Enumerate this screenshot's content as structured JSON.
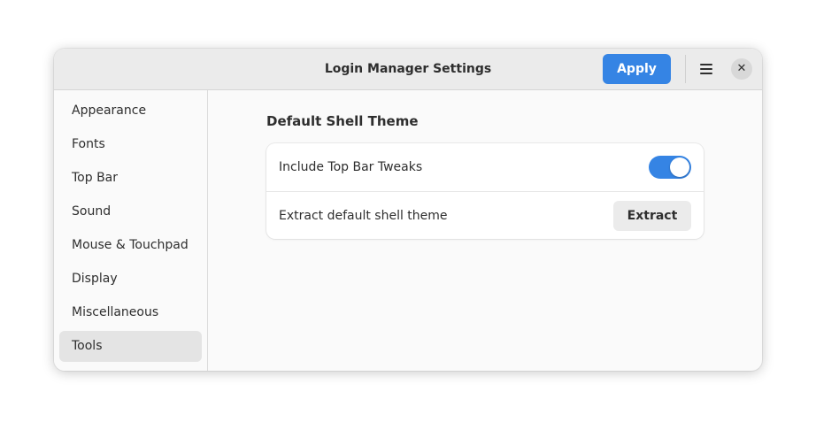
{
  "window": {
    "title": "Login Manager Settings"
  },
  "header": {
    "apply_label": "Apply",
    "menu_icon": "hamburger-menu-icon",
    "close_icon": "close-icon",
    "close_glyph": "✕"
  },
  "sidebar": {
    "items": [
      {
        "label": "Appearance",
        "selected": false
      },
      {
        "label": "Fonts",
        "selected": false
      },
      {
        "label": "Top Bar",
        "selected": false
      },
      {
        "label": "Sound",
        "selected": false
      },
      {
        "label": "Mouse & Touchpad",
        "selected": false
      },
      {
        "label": "Display",
        "selected": false
      },
      {
        "label": "Miscellaneous",
        "selected": false
      },
      {
        "label": "Tools",
        "selected": true
      }
    ]
  },
  "main": {
    "section_title": "Default Shell Theme",
    "rows": [
      {
        "label": "Include Top Bar Tweaks",
        "control": "toggle",
        "toggle_on": true
      },
      {
        "label": "Extract default shell theme",
        "control": "button",
        "button_label": "Extract"
      }
    ]
  },
  "colors": {
    "accent": "#3584e4",
    "headerbar": "#ebebeb",
    "sidebar_selected": "#e4e4e4"
  }
}
